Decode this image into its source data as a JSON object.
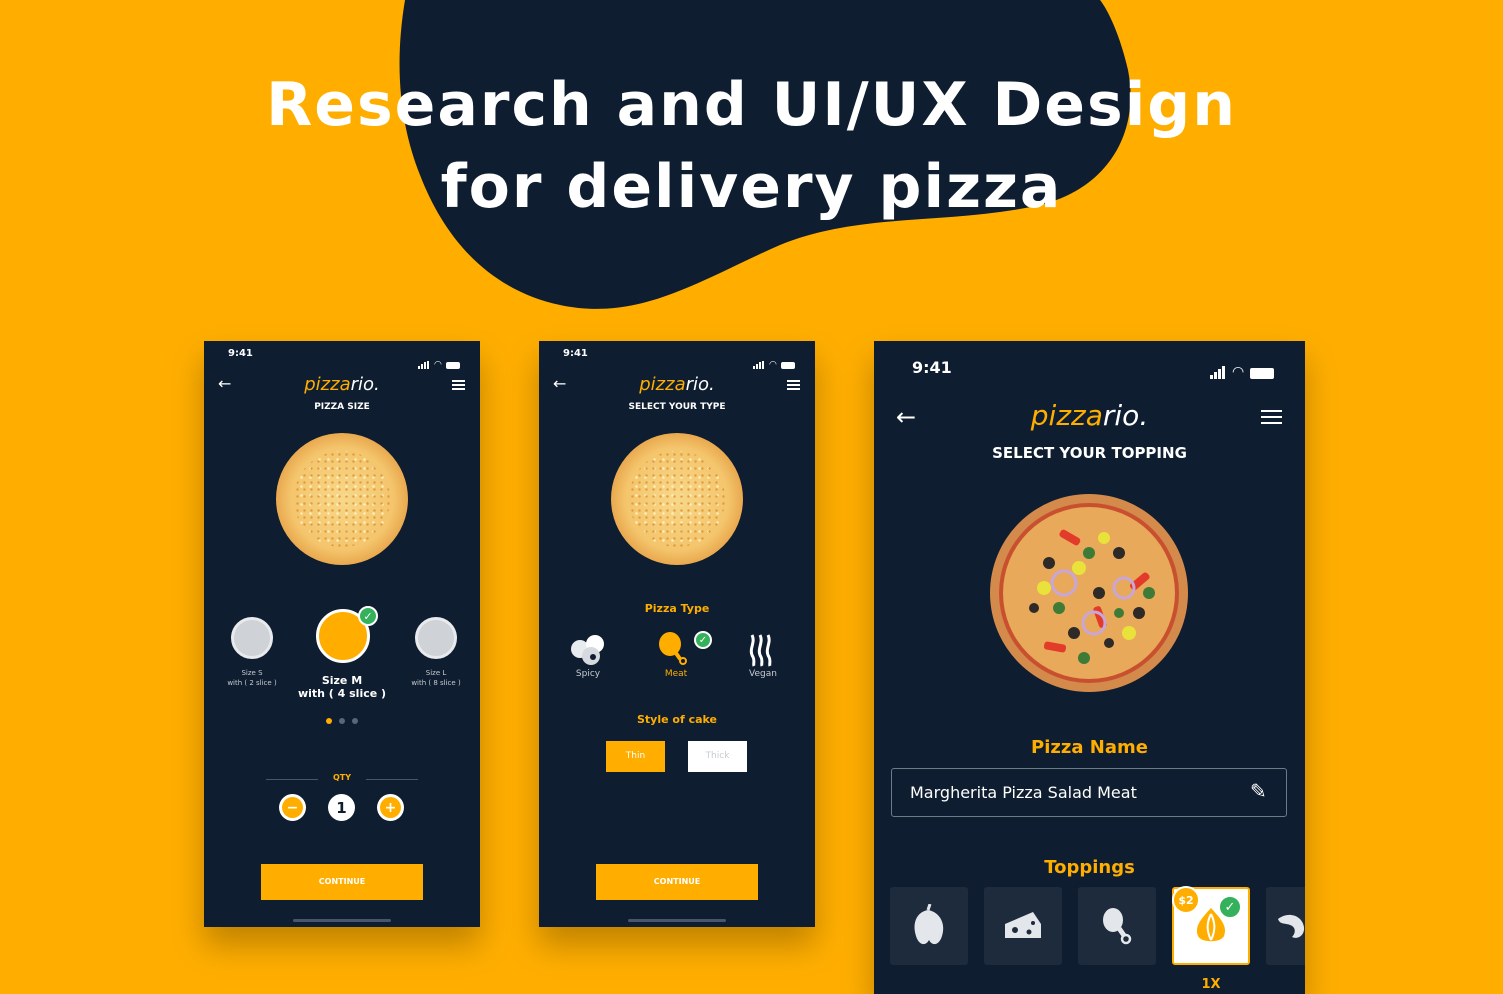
{
  "colors": {
    "accent": "#FFAE00",
    "navy": "#0E1D2F",
    "success": "#34B15A"
  },
  "headline": {
    "line1": "Research and UI/UX Design",
    "line2": "for delivery pizza"
  },
  "logo": {
    "part1": "pizza",
    "part2": "rio."
  },
  "phone1": {
    "time": "9:41",
    "subtitle": "PIZZA SIZE",
    "sizes": [
      {
        "name": "Size S",
        "desc": "with ( 2 slice )"
      },
      {
        "name": "Size M",
        "desc": "with ( 4 slice )"
      },
      {
        "name": "Size L",
        "desc": "with ( 8 slice )"
      }
    ],
    "selected_size": "Size M",
    "qty_label": "QTY",
    "qty_value": "1",
    "minus_icon": "minus-icon",
    "plus_icon": "plus-icon",
    "continue": "CONTINUE"
  },
  "phone2": {
    "time": "9:41",
    "subtitle": "SELECT YOUR TYPE",
    "pizza_type_label": "Pizza Type",
    "types": [
      "Spicy",
      "Meat",
      "Vegan"
    ],
    "selected_type": "Meat",
    "style_label": "Style of cake",
    "styles": [
      "Thin",
      "Thick"
    ],
    "selected_style": "Thin",
    "continue": "CONTINUE"
  },
  "phone3": {
    "time": "9:41",
    "subtitle": "SELECT YOUR TOPPING",
    "pizza_name_label": "Pizza Name",
    "pizza_name_value": "Margherita Pizza Salad Meat",
    "toppings_label": "Toppings",
    "toppings": [
      {
        "icon": "pepper-icon"
      },
      {
        "icon": "cheese-icon"
      },
      {
        "icon": "chicken-leg-icon"
      },
      {
        "icon": "onion-icon",
        "price": "$2",
        "qty": "1X",
        "selected": true
      },
      {
        "icon": "shrimp-icon"
      }
    ]
  }
}
